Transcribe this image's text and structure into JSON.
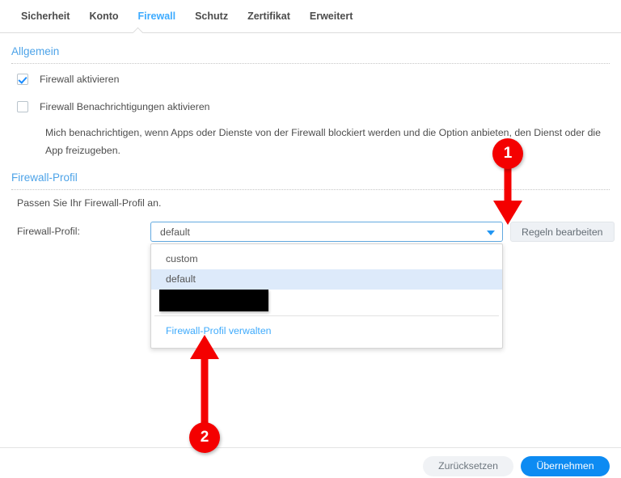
{
  "tabs": [
    {
      "label": "Sicherheit",
      "active": false
    },
    {
      "label": "Konto",
      "active": false
    },
    {
      "label": "Firewall",
      "active": true
    },
    {
      "label": "Schutz",
      "active": false
    },
    {
      "label": "Zertifikat",
      "active": false
    },
    {
      "label": "Erweitert",
      "active": false
    }
  ],
  "general": {
    "heading": "Allgemein",
    "checkbox_firewall_enable": {
      "label": "Firewall aktivieren",
      "checked": true
    },
    "checkbox_notifications_enable": {
      "label": "Firewall Benachrichtigungen aktivieren",
      "checked": false
    },
    "notification_description": "Mich benachrichtigen, wenn Apps oder Dienste von der Firewall blockiert werden und die Option anbieten, den Dienst oder die App freizugeben."
  },
  "profile": {
    "heading": "Firewall-Profil",
    "description": "Passen Sie Ihr Firewall-Profil an.",
    "field_label": "Firewall-Profil:",
    "selected_value": "default",
    "edit_rules_button": "Regeln bearbeiten",
    "dropdown": {
      "options": [
        {
          "label": "custom",
          "selected": false,
          "redacted": false
        },
        {
          "label": "default",
          "selected": true,
          "redacted": false
        },
        {
          "label": "",
          "selected": false,
          "redacted": true
        }
      ],
      "manage_link": "Firewall-Profil verwalten"
    }
  },
  "footer": {
    "reset_button": "Zurücksetzen",
    "apply_button": "Übernehmen"
  },
  "annotations": [
    {
      "number": "1"
    },
    {
      "number": "2"
    }
  ],
  "colors": {
    "accent_blue": "#3dabff",
    "section_blue": "#4da3e8",
    "link_blue": "#3daafc",
    "primary_button": "#0d8bf2",
    "annotation_red": "#f40000"
  }
}
